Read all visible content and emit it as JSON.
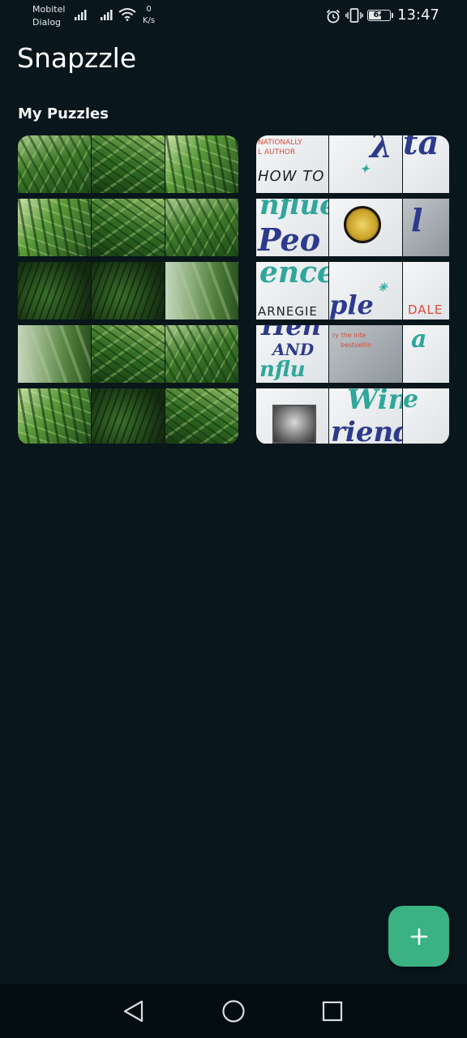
{
  "status_bar": {
    "carrier_1": "Mobitel",
    "carrier_2": "Dialog",
    "speed_value": "0",
    "speed_unit": "K/s",
    "battery": "64",
    "battery_level": 0.64,
    "time": "13:47",
    "icons": [
      "signal-icon",
      "signal-icon",
      "wifi-icon",
      "alarm-icon",
      "vibrate-icon",
      "battery-icon"
    ]
  },
  "app": {
    "title": "Snapzzle"
  },
  "section": {
    "title": "My Puzzles"
  },
  "puzzles": [
    {
      "name": "leaf-puzzle",
      "rows": 5,
      "cols": 3
    },
    {
      "name": "book-puzzle",
      "rows": 5,
      "cols": 3,
      "text_fragments": [
        "NATIONALLY",
        "L AUTHOR",
        "HOW TO",
        "nflue",
        "Peo",
        "ence",
        "ARNEGIE",
        "ple",
        "DALE",
        "AND",
        "ry the inte",
        "bestsellin",
        "Win",
        "riends"
      ]
    }
  ],
  "fab": {
    "icon": "plus-icon"
  },
  "nav": {
    "icons": [
      "back-triangle-icon",
      "home-circle-icon",
      "recents-square-icon"
    ]
  },
  "colors": {
    "background": "#09161b",
    "fab": "#3ab283",
    "nav_bar": "#040d10"
  }
}
